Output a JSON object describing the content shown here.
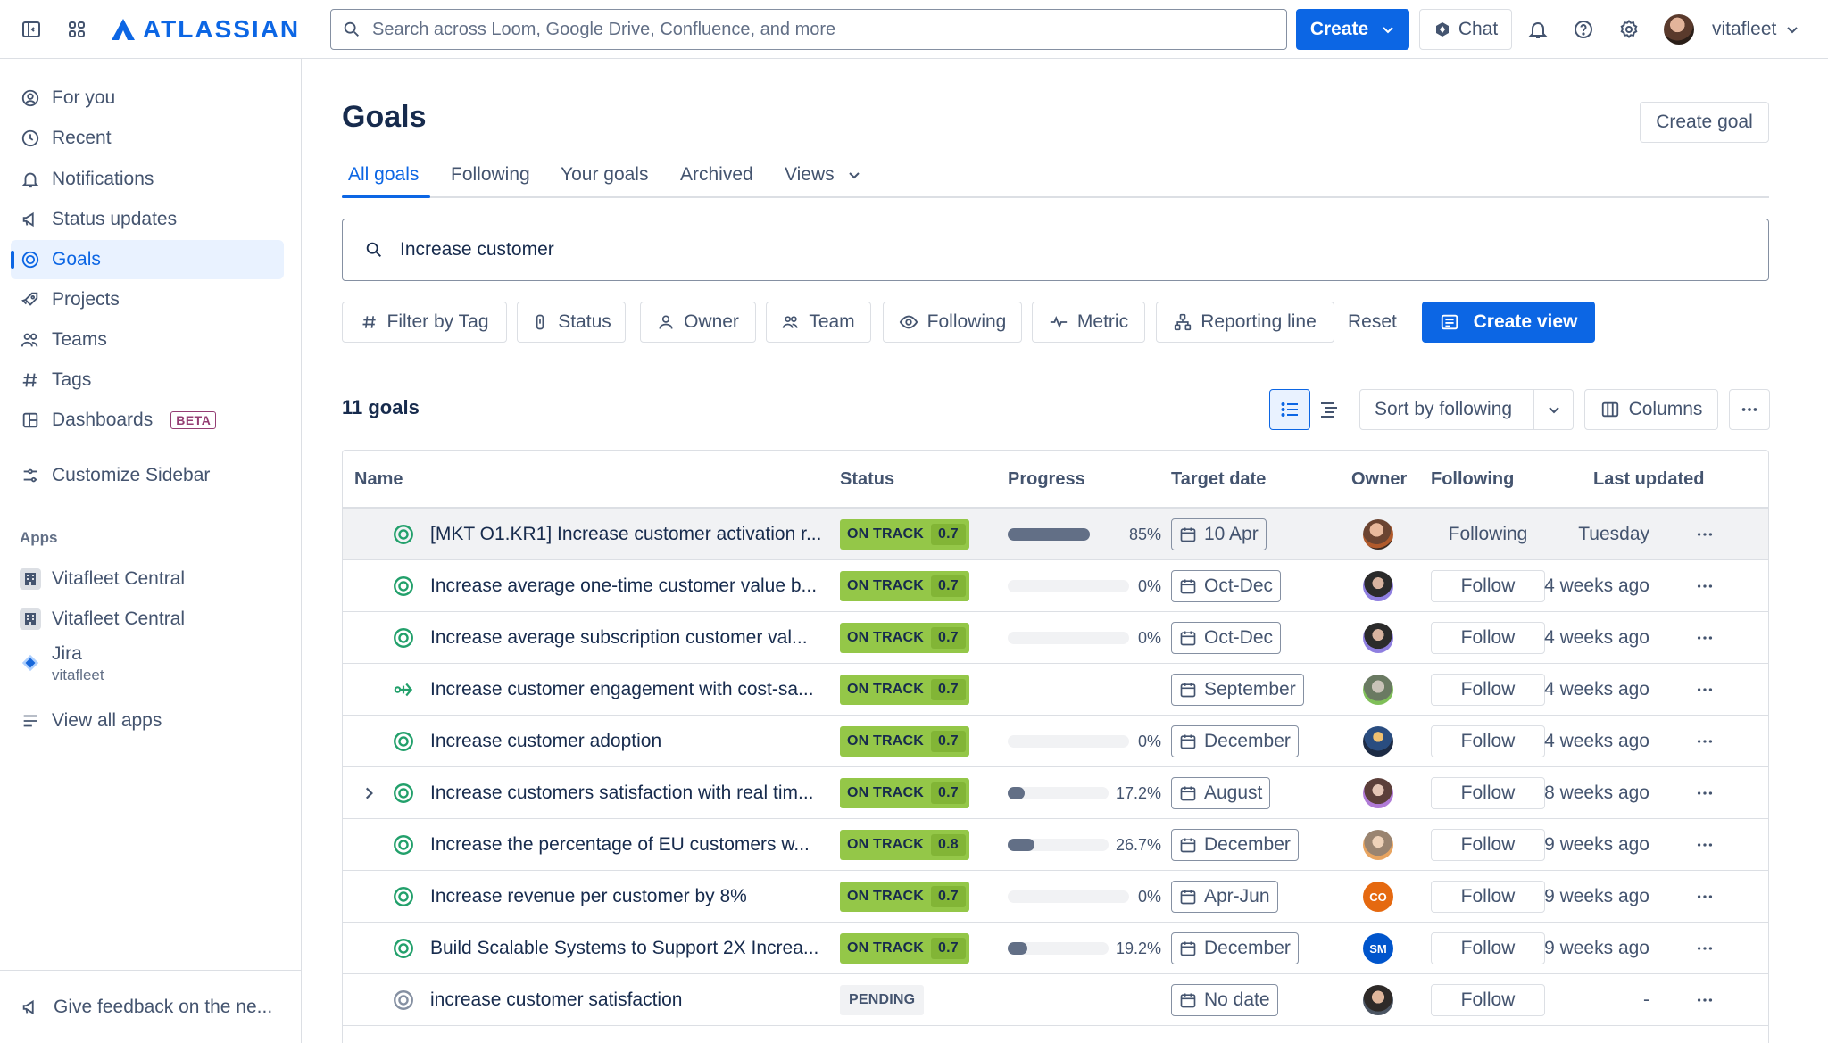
{
  "topbar": {
    "logo": "ATLASSIAN",
    "search_placeholder": "Search across Loom, Google Drive, Confluence, and more",
    "create_label": "Create",
    "chat_label": "Chat",
    "username": "vitafleet"
  },
  "sidebar": {
    "items": [
      {
        "label": "For you",
        "icon": "person-circle-icon"
      },
      {
        "label": "Recent",
        "icon": "clock-icon"
      },
      {
        "label": "Notifications",
        "icon": "bell-icon"
      },
      {
        "label": "Status updates",
        "icon": "megaphone-icon"
      },
      {
        "label": "Goals",
        "icon": "target-icon",
        "active": true
      },
      {
        "label": "Projects",
        "icon": "rocket-icon"
      },
      {
        "label": "Teams",
        "icon": "people-icon"
      },
      {
        "label": "Tags",
        "icon": "hash-icon"
      },
      {
        "label": "Dashboards",
        "icon": "dashboard-icon",
        "badge": "BETA"
      }
    ],
    "customize_label": "Customize Sidebar",
    "apps_heading": "Apps",
    "apps": [
      {
        "label": "Vitafleet Central"
      },
      {
        "label": "Vitafleet Central"
      },
      {
        "label": "Jira",
        "sub": "vitafleet"
      }
    ],
    "view_all_apps": "View all apps",
    "feedback": "Give feedback on the ne..."
  },
  "main": {
    "title": "Goals",
    "create_goal": "Create goal",
    "tabs": [
      "All goals",
      "Following",
      "Your goals",
      "Archived",
      "Views"
    ],
    "search_value": "Increase customer",
    "filters": [
      "Filter by Tag",
      "Status",
      "Owner",
      "Team",
      "Following",
      "Metric",
      "Reporting line"
    ],
    "reset": "Reset",
    "create_view": "Create view",
    "count": "11 goals",
    "sort_label": "Sort by following",
    "columns_label": "Columns"
  },
  "table": {
    "headers": [
      "Name",
      "Status",
      "Progress",
      "Target date",
      "Owner",
      "Following",
      "Last updated"
    ],
    "rows": [
      {
        "name": "[MKT O1.KR1] Increase customer activation r...",
        "status": "ON TRACK",
        "score": "0.7",
        "progress": "85%",
        "progress_value": 0.85,
        "date": "10 Apr",
        "owner": "avatar-1",
        "following": "Following",
        "updated": "Tuesday",
        "highlight": true
      },
      {
        "name": "Increase average one-time customer value b...",
        "status": "ON TRACK",
        "score": "0.7",
        "progress": "0%",
        "progress_value": 0,
        "date": "Oct-Dec",
        "owner": "avatar-2",
        "following": "Follow",
        "updated": "4 weeks ago"
      },
      {
        "name": "Increase average subscription customer val...",
        "status": "ON TRACK",
        "score": "0.7",
        "progress": "0%",
        "progress_value": 0,
        "date": "Oct-Dec",
        "owner": "avatar-2",
        "following": "Follow",
        "updated": "4 weeks ago"
      },
      {
        "name": "Increase customer engagement with cost-sa...",
        "status": "ON TRACK",
        "score": "0.7",
        "progress": "",
        "progress_value": null,
        "date": "September",
        "owner": "avatar-3",
        "following": "Follow",
        "updated": "4 weeks ago",
        "alt_icon": true
      },
      {
        "name": "Increase customer adoption",
        "status": "ON TRACK",
        "score": "0.7",
        "progress": "0%",
        "progress_value": 0,
        "date": "December",
        "owner": "avatar-4",
        "following": "Follow",
        "updated": "4 weeks ago"
      },
      {
        "name": "Increase customers satisfaction with real tim...",
        "status": "ON TRACK",
        "score": "0.7",
        "progress": "17.2%",
        "progress_value": 0.172,
        "date": "August",
        "owner": "avatar-5",
        "following": "Follow",
        "updated": "8 weeks ago",
        "expandable": true
      },
      {
        "name": "Increase the percentage of EU customers w...",
        "status": "ON TRACK",
        "score": "0.8",
        "progress": "26.7%",
        "progress_value": 0.267,
        "date": "December",
        "owner": "avatar-6",
        "following": "Follow",
        "updated": "9 weeks ago"
      },
      {
        "name": "Increase revenue per customer by 8%",
        "status": "ON TRACK",
        "score": "0.7",
        "progress": "0%",
        "progress_value": 0,
        "date": "Apr-Jun",
        "owner": "CO",
        "following": "Follow",
        "updated": "9 weeks ago"
      },
      {
        "name": "Build Scalable Systems to Support 2X Increa...",
        "status": "ON TRACK",
        "score": "0.7",
        "progress": "19.2%",
        "progress_value": 0.192,
        "date": "December",
        "owner": "SM",
        "following": "Follow",
        "updated": "9 weeks ago"
      },
      {
        "name": "increase customer satisfaction",
        "status": "PENDING",
        "score": "",
        "progress": "",
        "progress_value": null,
        "date": "No date",
        "owner": "avatar-7",
        "following": "Follow",
        "updated": "-",
        "pending": true
      }
    ]
  },
  "colors": {
    "accent": "#0c66e4",
    "on_track": "#94c748",
    "orange_avatar": "#e56910",
    "blue_avatar": "#0055cc"
  }
}
